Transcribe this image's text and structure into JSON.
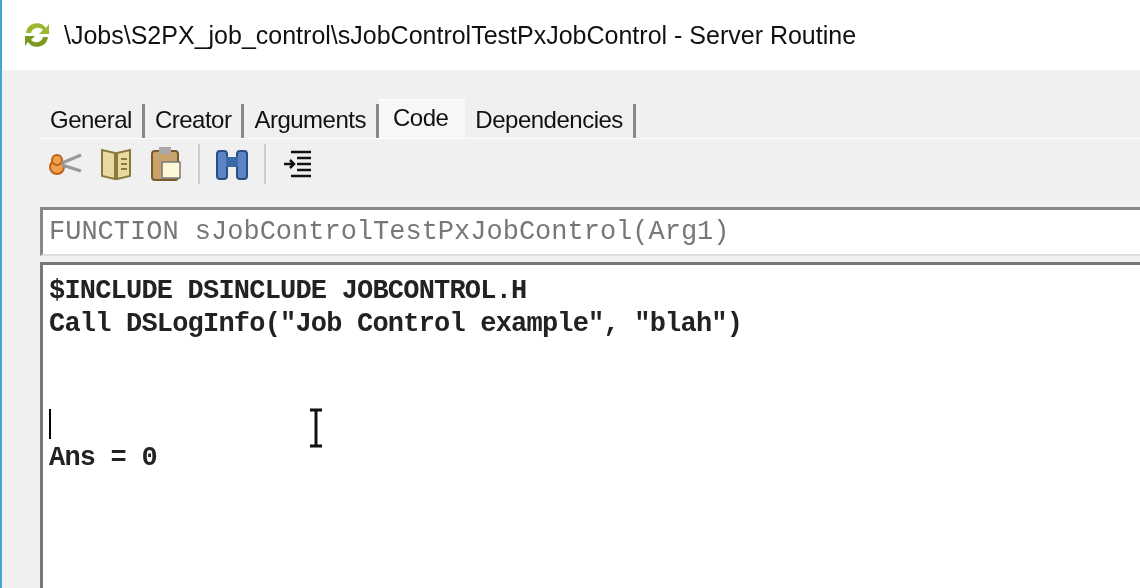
{
  "window": {
    "title": "\\Jobs\\S2PX_job_control\\sJobControlTestPxJobControl - Server Routine"
  },
  "tabs": [
    {
      "label": "General",
      "selected": false
    },
    {
      "label": "Creator",
      "selected": false
    },
    {
      "label": "Arguments",
      "selected": false
    },
    {
      "label": "Code",
      "selected": true
    },
    {
      "label": "Dependencies",
      "selected": false
    }
  ],
  "toolbar": [
    {
      "kind": "cut"
    },
    {
      "kind": "copy"
    },
    {
      "kind": "paste"
    },
    {
      "kind": "separator"
    },
    {
      "kind": "find"
    },
    {
      "kind": "separator"
    },
    {
      "kind": "indent"
    }
  ],
  "function_header": {
    "value": "FUNCTION sJobControlTestPxJobControl(Arg1)"
  },
  "code": {
    "lines": [
      {
        "kind": "text",
        "text": "$INCLUDE DSINCLUDE JOBCONTROL.H"
      },
      {
        "kind": "text",
        "text": "Call DSLogInfo(\"Job Control example\", \"blah\")"
      },
      {
        "kind": "blank"
      },
      {
        "kind": "blank"
      },
      {
        "kind": "caret"
      },
      {
        "kind": "text",
        "text": "Ans = 0"
      }
    ]
  }
}
